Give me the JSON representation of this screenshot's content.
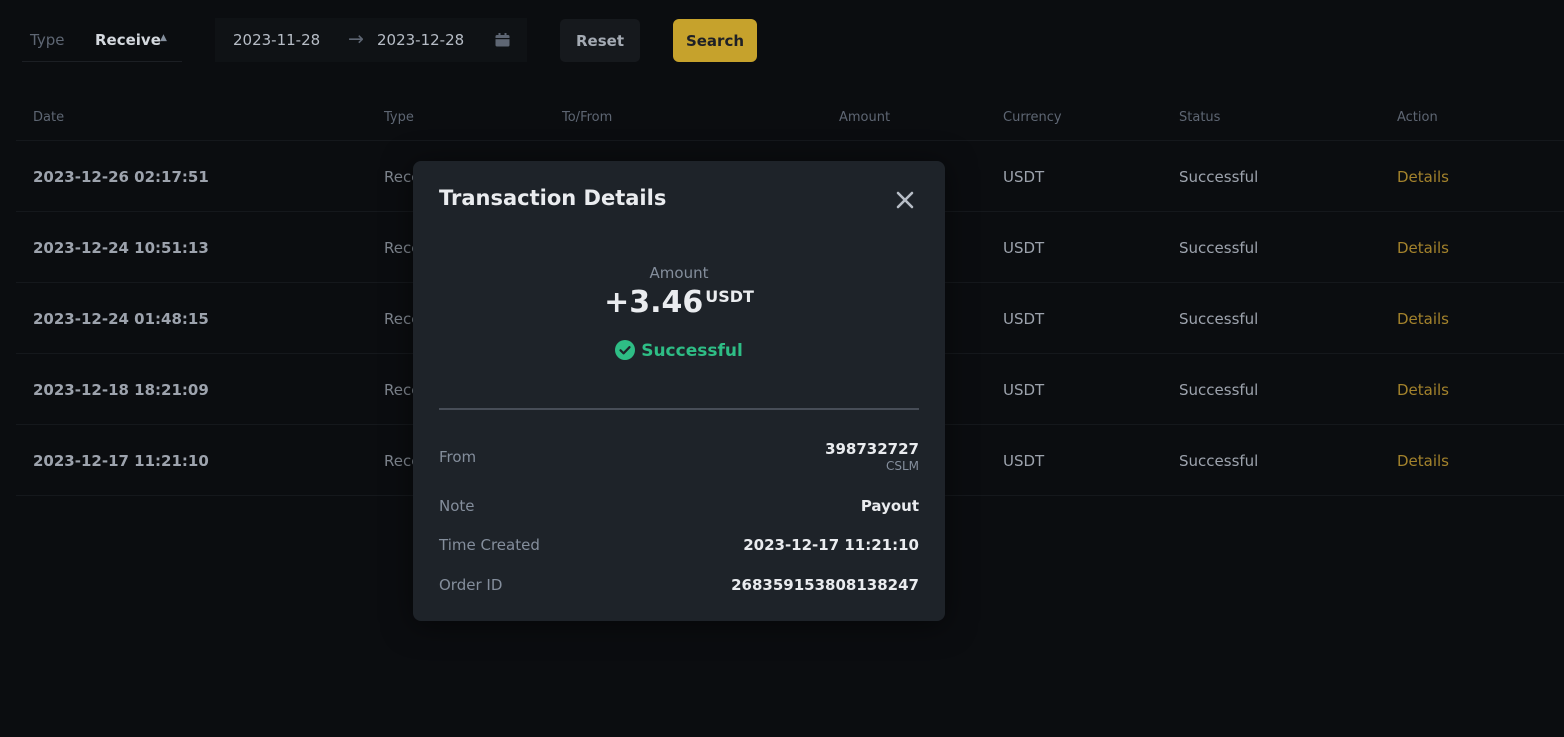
{
  "filters": {
    "type_label": "Type",
    "type_value": "Receive",
    "start_date": "2023-11-28",
    "end_date": "2023-12-28",
    "reset_label": "Reset",
    "search_label": "Search"
  },
  "table": {
    "headers": [
      "Date",
      "Type",
      "To/From",
      "Amount",
      "Currency",
      "Status",
      "Action"
    ],
    "rows": [
      {
        "date": "2023-12-26 02:17:51",
        "type": "Rece",
        "currency": "USDT",
        "status": "Successful",
        "action": "Details"
      },
      {
        "date": "2023-12-24 10:51:13",
        "type": "Rece",
        "currency": "USDT",
        "status": "Successful",
        "action": "Details"
      },
      {
        "date": "2023-12-24 01:48:15",
        "type": "Rece",
        "currency": "USDT",
        "status": "Successful",
        "action": "Details"
      },
      {
        "date": "2023-12-18 18:21:09",
        "type": "Rece",
        "currency": "USDT",
        "status": "Successful",
        "action": "Details"
      },
      {
        "date": "2023-12-17 11:21:10",
        "type": "Rece",
        "currency": "USDT",
        "status": "Successful",
        "action": "Details"
      }
    ]
  },
  "modal": {
    "title": "Transaction Details",
    "amount_label": "Amount",
    "amount_value": "+3.46",
    "amount_unit": "USDT",
    "status": "Successful",
    "from_label": "From",
    "from_value": "398732727",
    "from_sub": "CSLM",
    "note_label": "Note",
    "note_value": "Payout",
    "time_label": "Time Created",
    "time_value": "2023-12-17 11:21:10",
    "order_label": "Order ID",
    "order_value": "268359153808138247"
  },
  "colors": {
    "background": "#0b0d10",
    "accent": "#c6a22c",
    "success": "#2ebd85",
    "link": "#a3822c",
    "modal_bg": "#1e2329"
  },
  "icons": [
    "caret-up-icon",
    "arrow-right-icon",
    "calendar-icon",
    "close-icon",
    "check-circle-icon"
  ]
}
